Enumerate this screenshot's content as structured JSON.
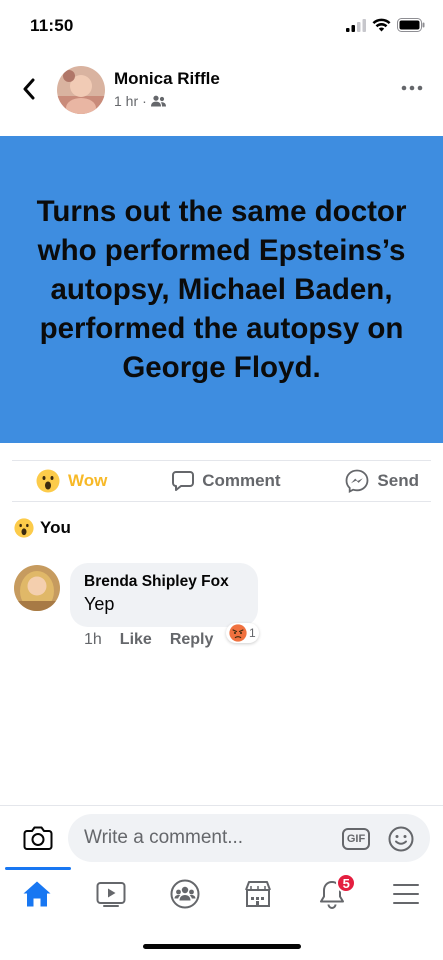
{
  "status_bar": {
    "time": "11:50"
  },
  "post": {
    "author": "Monica Riffle",
    "time": "1 hr",
    "separator": "·",
    "text": "Turns out the same doctor who performed Epsteins’s autopsy, Michael Baden, performed the autopsy on George Floyd.",
    "banner_color": "#3e8de0"
  },
  "actions": {
    "wow_label": "Wow",
    "comment_label": "Comment",
    "send_label": "Send"
  },
  "reactions": {
    "summary_label": "You"
  },
  "comment": {
    "author": "Brenda Shipley Fox",
    "text": "Yep",
    "time": "1h",
    "like_label": "Like",
    "reply_label": "Reply",
    "reaction_count": "1"
  },
  "composer": {
    "placeholder": "Write a comment...",
    "gif_label": "GIF"
  },
  "tabs": {
    "notifications_badge": "5",
    "items": [
      "home-icon",
      "watch-icon",
      "groups-icon",
      "marketplace-icon",
      "notifications-icon",
      "menu-icon"
    ]
  },
  "colors": {
    "accent": "#1877f2",
    "wow": "#f7b928",
    "badge": "#e41e3f"
  }
}
